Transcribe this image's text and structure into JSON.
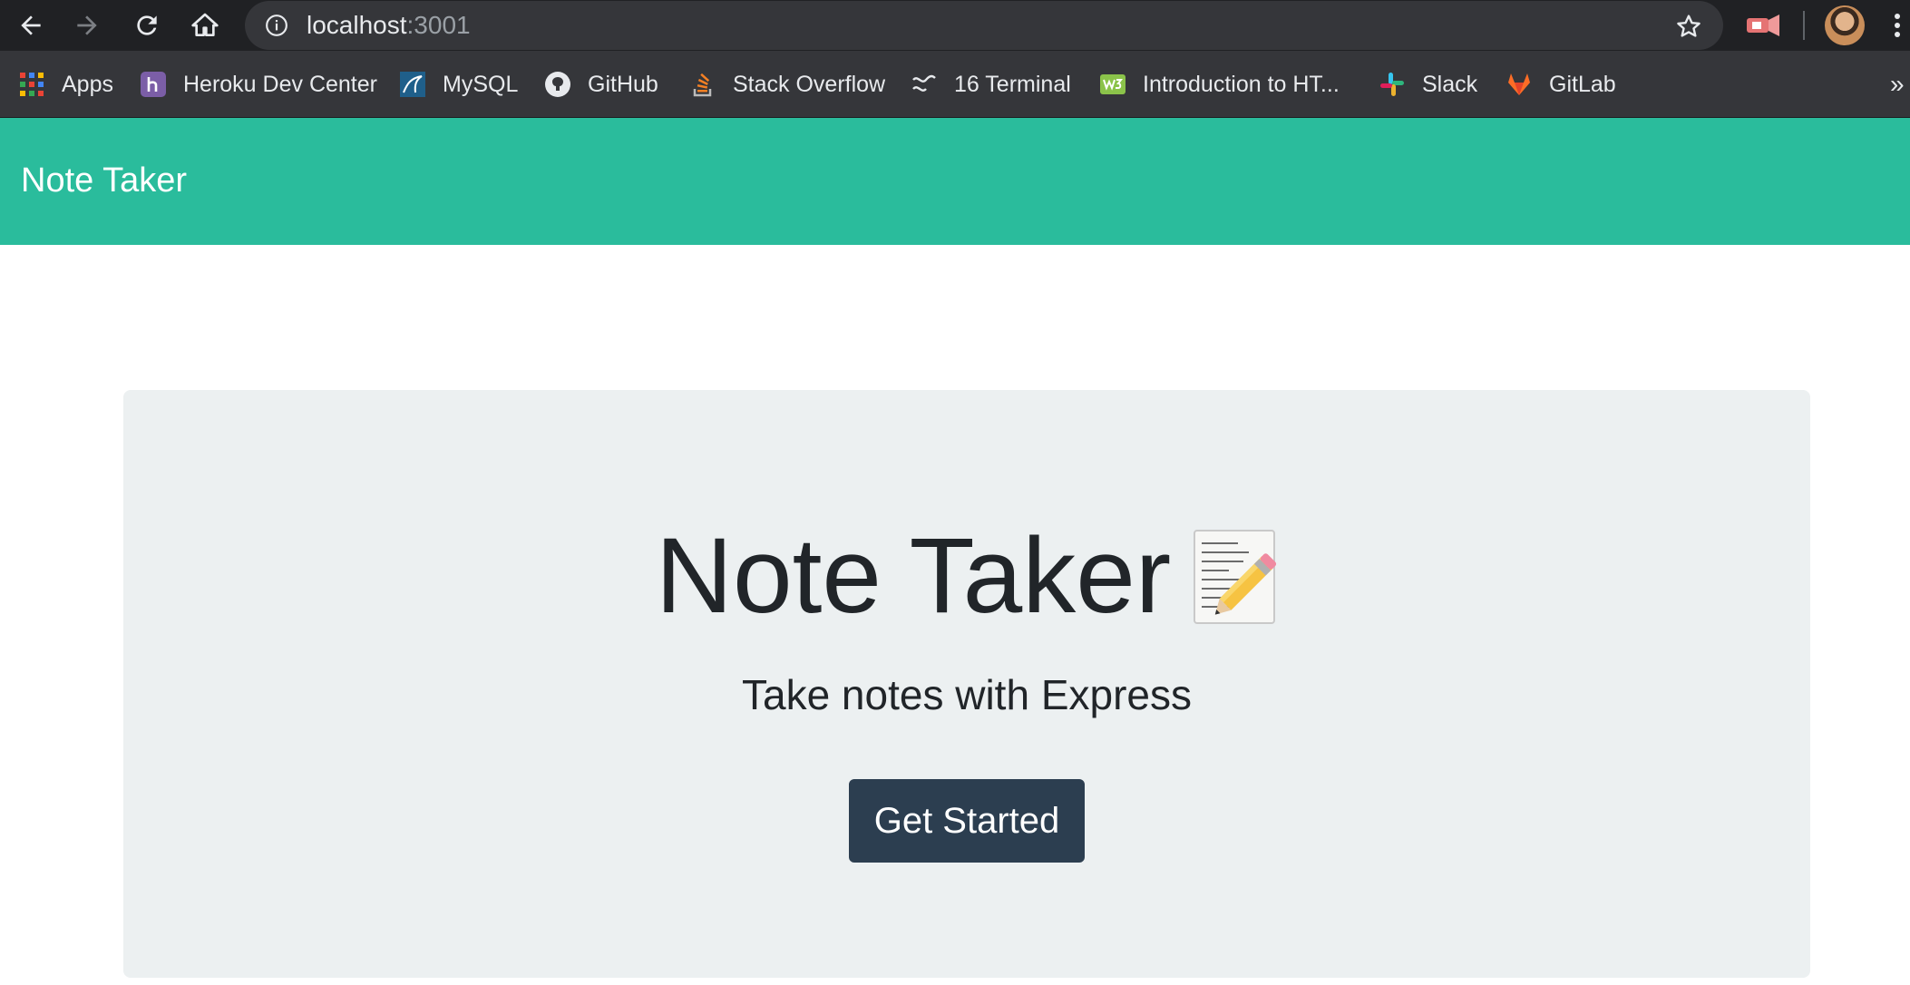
{
  "browser": {
    "url_host": "localhost",
    "url_port": ":3001",
    "bookmarks": [
      {
        "label": "Apps",
        "icon": "apps-grid-icon"
      },
      {
        "label": "Heroku Dev Center",
        "icon": "heroku-icon"
      },
      {
        "label": "MySQL",
        "icon": "mysql-icon"
      },
      {
        "label": "GitHub",
        "icon": "github-icon"
      },
      {
        "label": "Stack Overflow",
        "icon": "stackoverflow-icon"
      },
      {
        "label": "16 Terminal",
        "icon": "terminal-icon"
      },
      {
        "label": "Introduction to HT...",
        "icon": "w3schools-icon"
      },
      {
        "label": "Slack",
        "icon": "slack-icon"
      },
      {
        "label": "GitLab",
        "icon": "gitlab-icon"
      }
    ],
    "overflow_label": "»"
  },
  "navbar": {
    "brand": "Note Taker",
    "color": "#2abc9c"
  },
  "hero": {
    "title": "Note Taker",
    "subtitle": "Take notes with Express",
    "button_label": "Get Started",
    "button_color": "#2c3e50",
    "panel_color": "#ecf0f1"
  }
}
